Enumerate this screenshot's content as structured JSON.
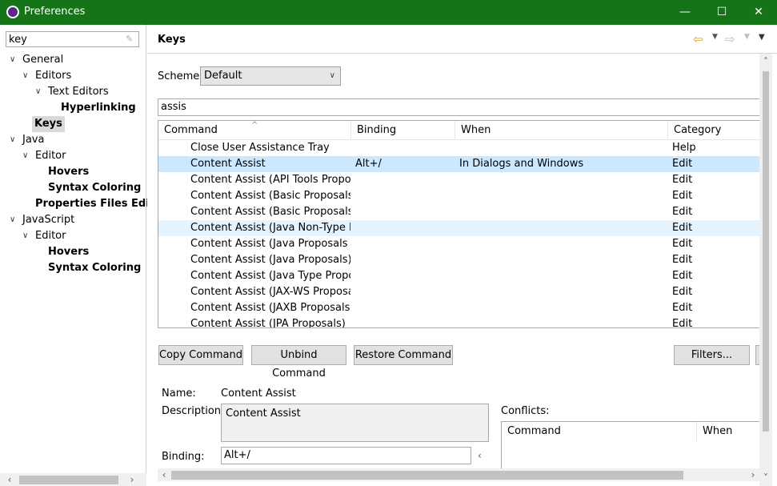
{
  "window": {
    "title": "Preferences",
    "minimize": "—",
    "maximize": "☐",
    "close": "✕"
  },
  "filter": {
    "value": "key"
  },
  "tree": [
    {
      "label": "General",
      "toggle": "v",
      "bold": false
    },
    {
      "label": "Editors",
      "toggle": "v",
      "bold": false
    },
    {
      "label": "Text Editors",
      "toggle": "v",
      "bold": false
    },
    {
      "label": "Hyperlinking",
      "toggle": "",
      "bold": true
    },
    {
      "label": "Keys",
      "toggle": "",
      "bold": true,
      "selected": true
    },
    {
      "label": "Java",
      "toggle": "v",
      "bold": false
    },
    {
      "label": "Editor",
      "toggle": "v",
      "bold": false
    },
    {
      "label": "Hovers",
      "toggle": "",
      "bold": true
    },
    {
      "label": "Syntax Coloring",
      "toggle": "",
      "bold": true
    },
    {
      "label": "Properties Files Edito",
      "toggle": "",
      "bold": true
    },
    {
      "label": "JavaScript",
      "toggle": "v",
      "bold": false
    },
    {
      "label": "Editor",
      "toggle": "v",
      "bold": false
    },
    {
      "label": "Hovers",
      "toggle": "",
      "bold": true
    },
    {
      "label": "Syntax Coloring",
      "toggle": "",
      "bold": true
    }
  ],
  "page": {
    "title": "Keys"
  },
  "scheme": {
    "label": "Scheme:",
    "value": "Default"
  },
  "search": {
    "value": "assis"
  },
  "table": {
    "headers": [
      "Command",
      "Binding",
      "When",
      "Category"
    ],
    "rows": [
      {
        "command": "Close User Assistance Tray",
        "binding": "",
        "when": "",
        "category": "Help"
      },
      {
        "command": "Content Assist",
        "binding": "Alt+/",
        "when": "In Dialogs and Windows",
        "category": "Edit"
      },
      {
        "command": "Content Assist (API Tools Proposal",
        "binding": "",
        "when": "",
        "category": "Edit"
      },
      {
        "command": "Content Assist (Basic Proposals)",
        "binding": "",
        "when": "",
        "category": "Edit"
      },
      {
        "command": "Content Assist (Basic Proposals)",
        "binding": "",
        "when": "",
        "category": "Edit"
      },
      {
        "command": "Content Assist (Java Non-Type Pro",
        "binding": "",
        "when": "",
        "category": "Edit"
      },
      {
        "command": "Content Assist (Java Proposals (Ta",
        "binding": "",
        "when": "",
        "category": "Edit"
      },
      {
        "command": "Content Assist (Java Proposals)",
        "binding": "",
        "when": "",
        "category": "Edit"
      },
      {
        "command": "Content Assist (Java Type Proposa",
        "binding": "",
        "when": "",
        "category": "Edit"
      },
      {
        "command": "Content Assist (JAX-WS Proposals)",
        "binding": "",
        "when": "",
        "category": "Edit"
      },
      {
        "command": "Content Assist (JAXB Proposals)",
        "binding": "",
        "when": "",
        "category": "Edit"
      },
      {
        "command": "Content Assist (JPA Proposals)",
        "binding": "",
        "when": "",
        "category": "Edit"
      }
    ]
  },
  "buttons": {
    "copy": "Copy Command",
    "unbind": "Unbind Command",
    "restore": "Restore Command",
    "filters": "Filters..."
  },
  "details": {
    "name_label": "Name:",
    "name_value": "Content Assist",
    "desc_label": "Description:",
    "desc_value": "Content Assist",
    "binding_label": "Binding:",
    "binding_value": "Alt+/",
    "conflicts_label": "Conflicts:",
    "conflicts_headers": [
      "Command",
      "When"
    ]
  }
}
